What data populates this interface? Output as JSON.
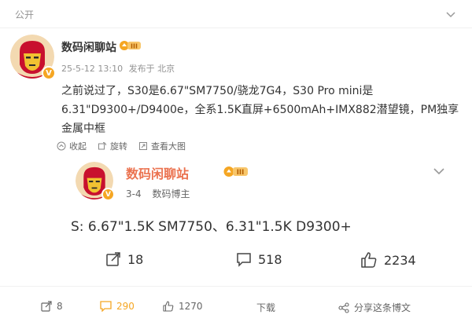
{
  "header": {
    "visibility": "公开"
  },
  "author": {
    "name": "数码闲聊站",
    "level": "III",
    "verified_mark": "V",
    "date": "25-5-12 13:10",
    "source": "发布于 北京"
  },
  "post": {
    "text": "之前说过了，S30是6.67\"SM7750/骁龙7G4，S30 Pro mini是6.31\"D9300+/D9400e，全系1.5K直屏+6500mAh+IMX882潜望镜，PM独享金属中框"
  },
  "inline_actions": [
    {
      "label": "收起",
      "icon": "collapse-icon"
    },
    {
      "label": "旋转",
      "icon": "rotate-icon"
    },
    {
      "label": "查看大图",
      "icon": "view-large-icon"
    }
  ],
  "quote": {
    "name": "数码闲聊站",
    "level": "III",
    "verified_mark": "V",
    "date": "3-4",
    "role": "数码博主",
    "text": "S: 6.67\"1.5K SM7750、6.31\"1.5K D9300+",
    "reposts": "18",
    "comments": "518",
    "likes": "2234"
  },
  "footer": {
    "reposts": "8",
    "comments": "290",
    "likes": "1270",
    "download": "下载",
    "share": "分享这条博文"
  },
  "colors": {
    "accent": "#f5a623",
    "name_orange": "#eb7350"
  }
}
